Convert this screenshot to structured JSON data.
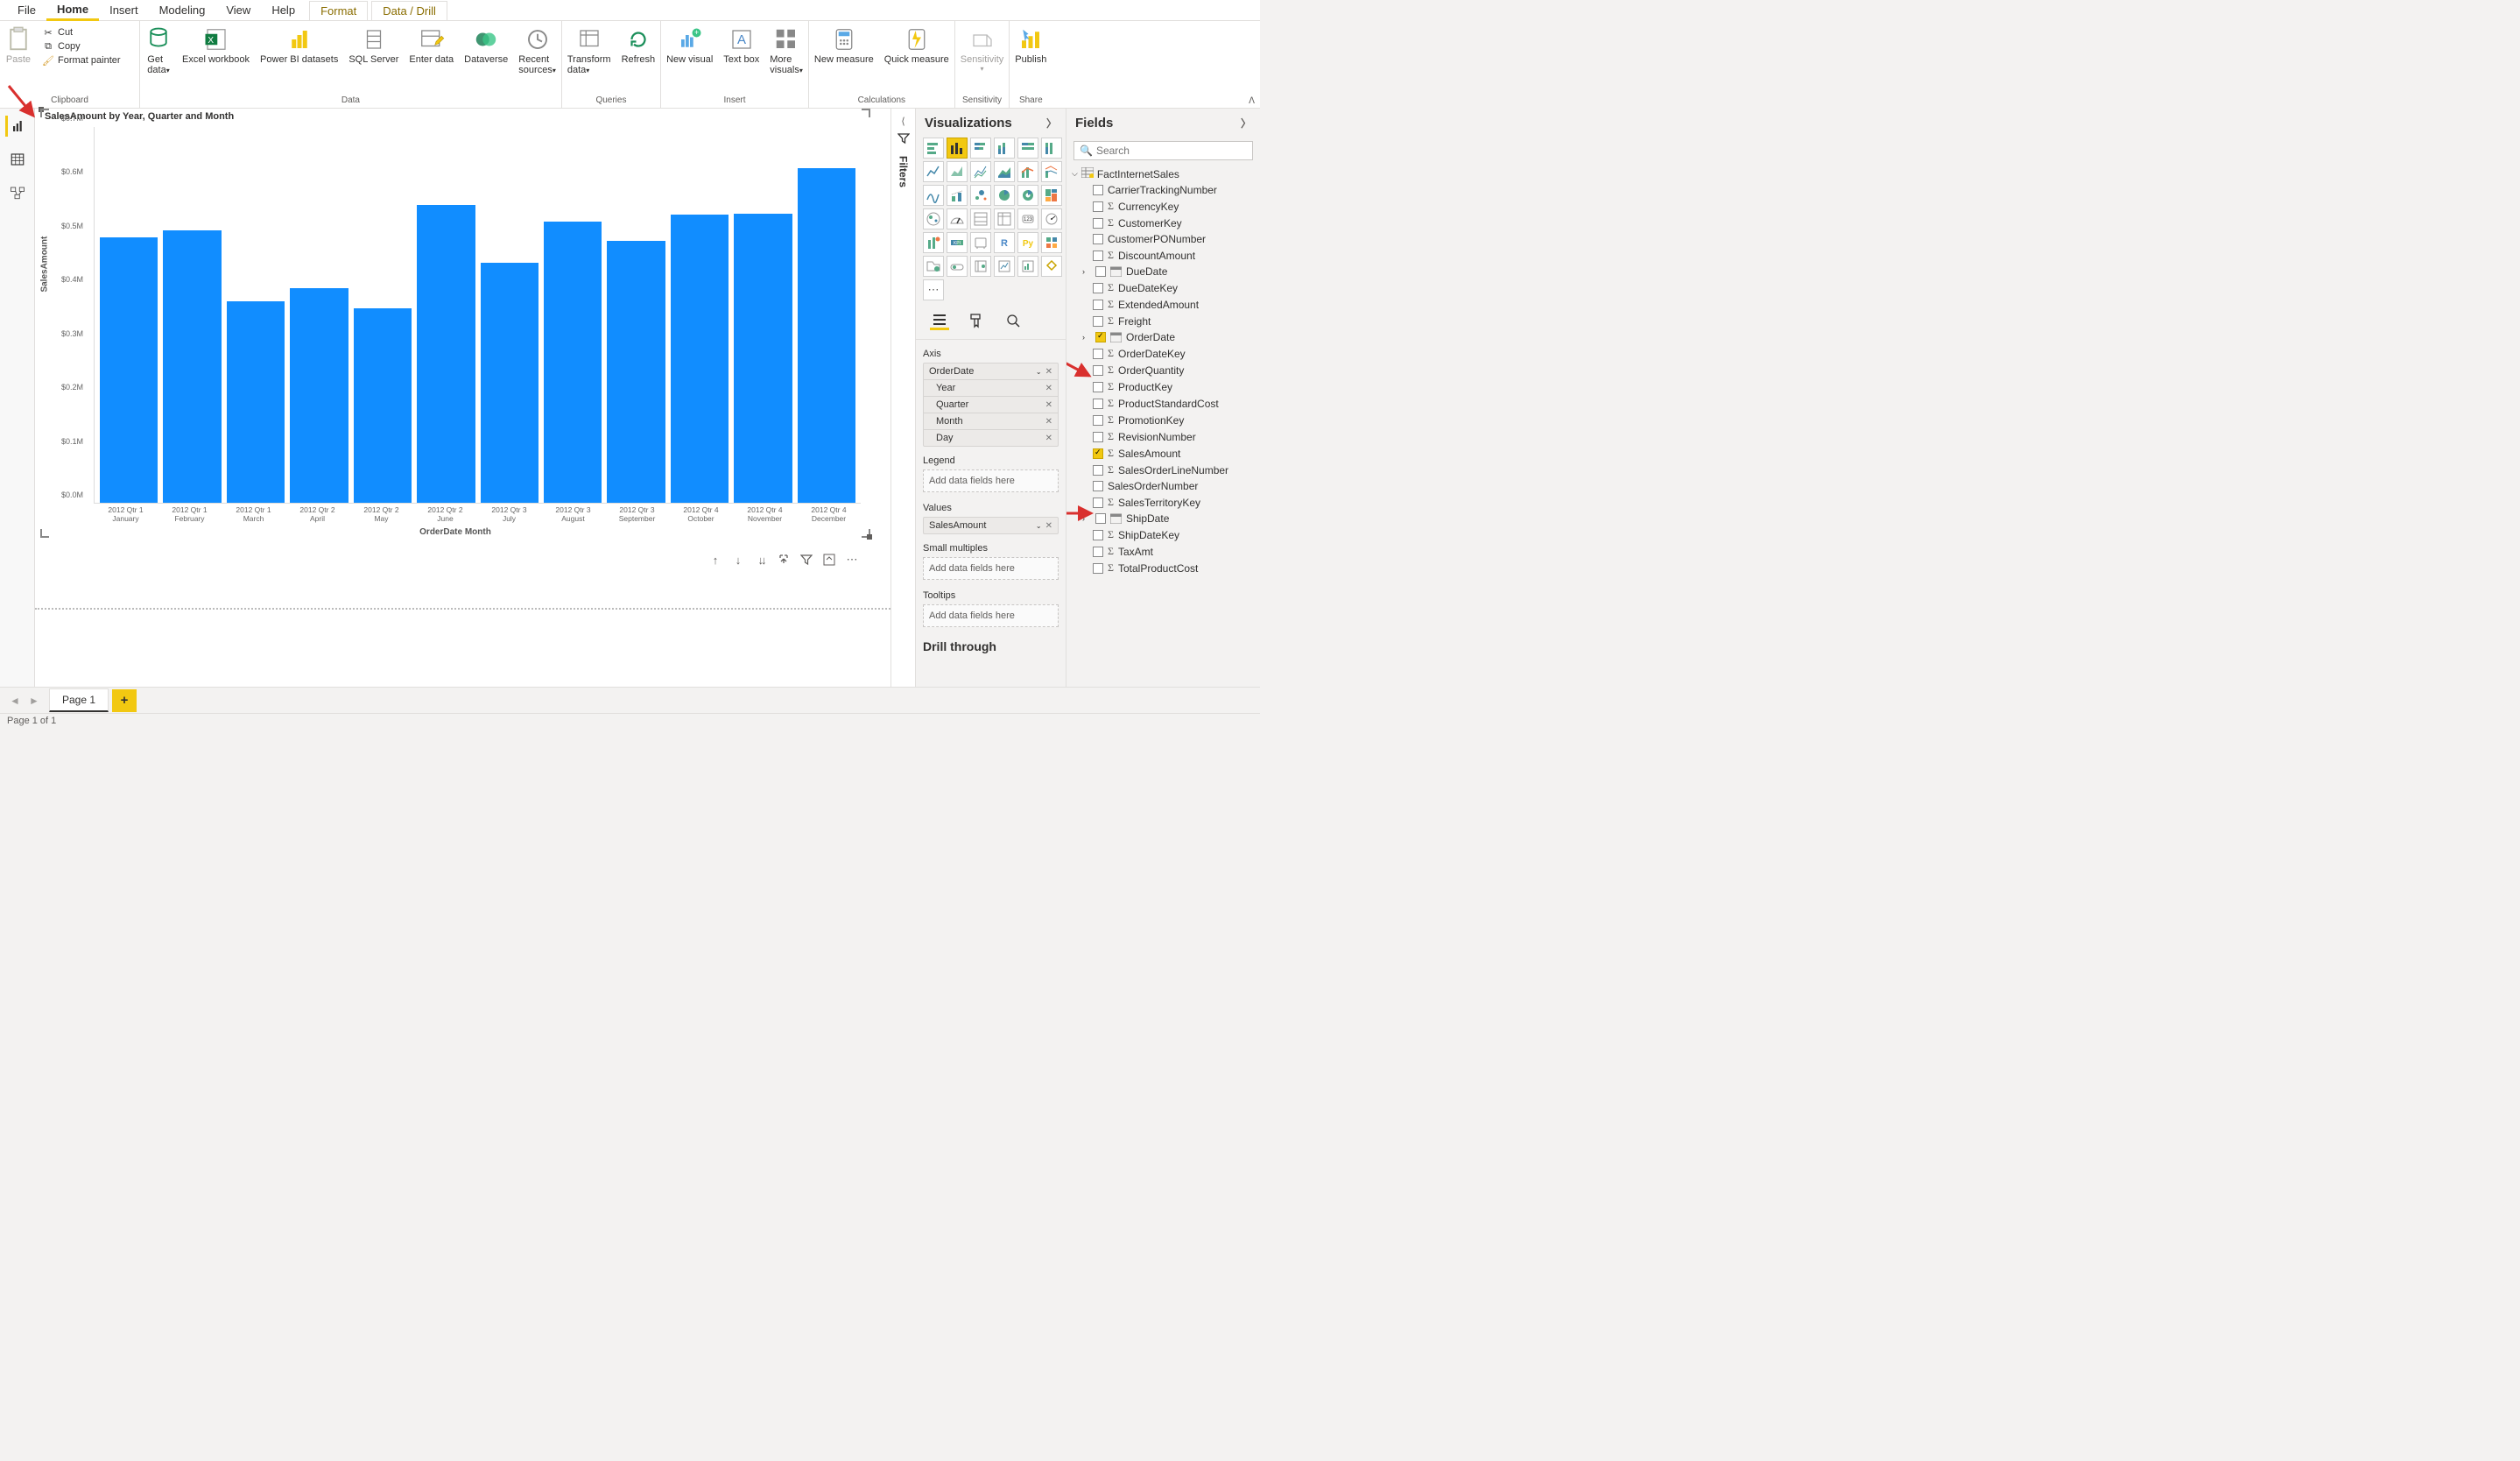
{
  "menu": {
    "file": "File",
    "home": "Home",
    "insert": "Insert",
    "modeling": "Modeling",
    "view": "View",
    "help": "Help",
    "format": "Format",
    "datadrill": "Data / Drill"
  },
  "ribbon": {
    "clipboard": {
      "label": "Clipboard",
      "paste": "Paste",
      "cut": "Cut",
      "copy": "Copy",
      "fp": "Format painter"
    },
    "data": {
      "label": "Data",
      "get": "Get data",
      "excel": "Excel workbook",
      "pbids": "Power BI datasets",
      "sql": "SQL Server",
      "enter": "Enter data",
      "dv": "Dataverse",
      "recent": "Recent sources"
    },
    "queries": {
      "label": "Queries",
      "transform": "Transform data",
      "refresh": "Refresh"
    },
    "insert": {
      "label": "Insert",
      "newvis": "New visual",
      "textbox": "Text box",
      "more": "More visuals"
    },
    "calc": {
      "label": "Calculations",
      "newmeas": "New measure",
      "quick": "Quick measure"
    },
    "sens": {
      "label": "Sensitivity",
      "btn": "Sensitivity"
    },
    "share": {
      "label": "Share",
      "publish": "Publish"
    }
  },
  "chart": {
    "title": "SalesAmount by Year, Quarter and Month",
    "ylabel": "SalesAmount",
    "xlabel": "OrderDate Month"
  },
  "chart_data": {
    "type": "bar",
    "title": "SalesAmount by Year, Quarter and Month",
    "xlabel": "OrderDate Month",
    "ylabel": "SalesAmount",
    "ylim": [
      0,
      700000
    ],
    "yticks": [
      "$0.0M",
      "$0.1M",
      "$0.2M",
      "$0.3M",
      "$0.4M",
      "$0.5M",
      "$0.6M",
      "$0.7M"
    ],
    "categories": [
      [
        "2012 Qtr 1",
        "January"
      ],
      [
        "2012 Qtr 1",
        "February"
      ],
      [
        "2012 Qtr 1",
        "March"
      ],
      [
        "2012 Qtr 2",
        "April"
      ],
      [
        "2012 Qtr 2",
        "May"
      ],
      [
        "2012 Qtr 2",
        "June"
      ],
      [
        "2012 Qtr 3",
        "July"
      ],
      [
        "2012 Qtr 3",
        "August"
      ],
      [
        "2012 Qtr 3",
        "September"
      ],
      [
        "2012 Qtr 4",
        "October"
      ],
      [
        "2012 Qtr 4",
        "November"
      ],
      [
        "2012 Qtr 4",
        "December"
      ]
    ],
    "values": [
      495000,
      508000,
      376000,
      400000,
      362000,
      555000,
      447000,
      524000,
      488000,
      537000,
      539000,
      623000
    ]
  },
  "filters": "Filters",
  "viz": {
    "header": "Visualizations",
    "axis": "Axis",
    "axis_field": "OrderDate",
    "axis_items": [
      "Year",
      "Quarter",
      "Month",
      "Day"
    ],
    "legend": "Legend",
    "values": "Values",
    "values_field": "SalesAmount",
    "sm": "Small multiples",
    "tooltips": "Tooltips",
    "drill": "Drill through",
    "placeholder": "Add data fields here"
  },
  "fields": {
    "header": "Fields",
    "search": "Search",
    "table": "FactInternetSales",
    "items": [
      {
        "name": "CarrierTrackingNumber",
        "t": "txt"
      },
      {
        "name": "CurrencyKey",
        "t": "num"
      },
      {
        "name": "CustomerKey",
        "t": "num"
      },
      {
        "name": "CustomerPONumber",
        "t": "txt"
      },
      {
        "name": "DiscountAmount",
        "t": "num"
      },
      {
        "name": "DueDate",
        "t": "date",
        "hier": true
      },
      {
        "name": "DueDateKey",
        "t": "num"
      },
      {
        "name": "ExtendedAmount",
        "t": "num"
      },
      {
        "name": "Freight",
        "t": "num"
      },
      {
        "name": "OrderDate",
        "t": "date",
        "hier": true,
        "ck": true
      },
      {
        "name": "OrderDateKey",
        "t": "num"
      },
      {
        "name": "OrderQuantity",
        "t": "num"
      },
      {
        "name": "ProductKey",
        "t": "num"
      },
      {
        "name": "ProductStandardCost",
        "t": "num"
      },
      {
        "name": "PromotionKey",
        "t": "num"
      },
      {
        "name": "RevisionNumber",
        "t": "num"
      },
      {
        "name": "SalesAmount",
        "t": "num",
        "ck": true
      },
      {
        "name": "SalesOrderLineNumber",
        "t": "num"
      },
      {
        "name": "SalesOrderNumber",
        "t": "txt"
      },
      {
        "name": "SalesTerritoryKey",
        "t": "num"
      },
      {
        "name": "ShipDate",
        "t": "date",
        "hier": true
      },
      {
        "name": "ShipDateKey",
        "t": "num"
      },
      {
        "name": "TaxAmt",
        "t": "num"
      },
      {
        "name": "TotalProductCost",
        "t": "num"
      }
    ]
  },
  "page": {
    "tab": "Page 1",
    "status": "Page 1 of 1"
  }
}
